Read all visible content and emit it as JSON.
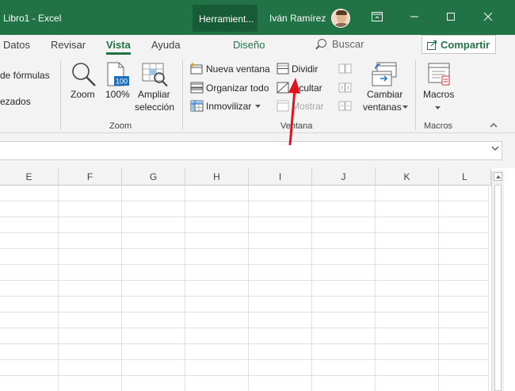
{
  "window": {
    "title": "Libro1  -  Excel",
    "tools_tab": "Herramient...",
    "user": "Iván Ramírez",
    "controls": [
      "share-icon",
      "minimize-icon",
      "maximize-icon",
      "close-icon"
    ]
  },
  "tabs": [
    "Datos",
    "Revisar",
    "Vista",
    "Ayuda",
    "Diseño"
  ],
  "active_tab": "Vista",
  "search": "Buscar",
  "share": "Compartir",
  "ribbon": {
    "show_partial": [
      "de fórmulas",
      "ezados"
    ],
    "zoom_group": {
      "label": "Zoom",
      "zoom": "Zoom",
      "hundred": "100%",
      "hundred_icon_text": "100",
      "fit_line1": "Ampliar",
      "fit_line2": "selección"
    },
    "window_group": {
      "label": "Ventana",
      "new_window": "Nueva ventana",
      "arrange_all": "Organizar todo",
      "freeze": "Inmovilizar",
      "split": "Dividir",
      "hide": "Ocultar",
      "unhide": "Mostrar",
      "switch_line1": "Cambiar",
      "switch_line2": "ventanas"
    },
    "macros_group": {
      "label": "Macros",
      "macros": "Macros"
    }
  },
  "columns": [
    "E",
    "F",
    "G",
    "H",
    "I",
    "J",
    "K",
    "L"
  ],
  "colors": {
    "brand": "#217346",
    "annotation": "#e0141e"
  }
}
